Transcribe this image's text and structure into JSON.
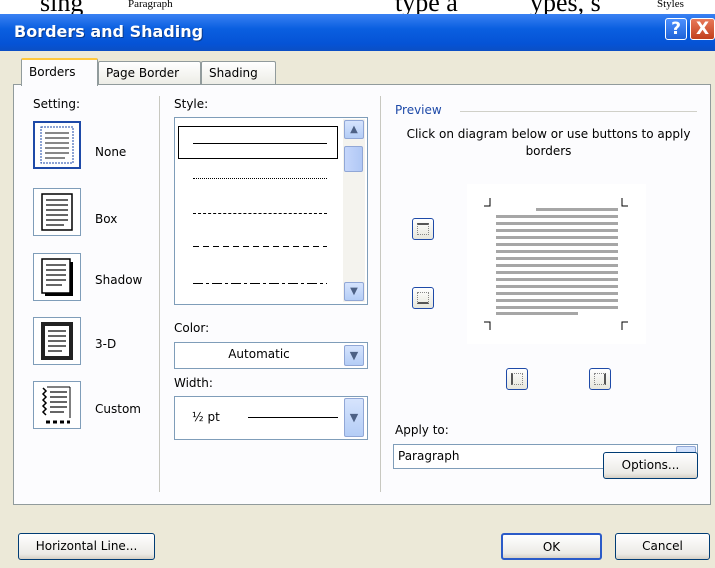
{
  "window": {
    "title": "Borders and Shading",
    "help_label": "?",
    "close_label": "X"
  },
  "background_doc": {
    "fragments": [
      "sing",
      "Paragraph",
      "type a",
      "ypes, s",
      "Styles"
    ]
  },
  "tabs": [
    {
      "label": "Borders",
      "active": true
    },
    {
      "label": "Page Border",
      "active": false
    },
    {
      "label": "Shading",
      "active": false
    }
  ],
  "setting": {
    "label": "Setting:",
    "options": [
      {
        "label": "None",
        "selected": true,
        "icon": "setting-none-icon"
      },
      {
        "label": "Box",
        "selected": false,
        "icon": "setting-box-icon"
      },
      {
        "label": "Shadow",
        "selected": false,
        "icon": "setting-shadow-icon"
      },
      {
        "label": "3-D",
        "selected": false,
        "icon": "setting-3d-icon"
      },
      {
        "label": "Custom",
        "selected": false,
        "icon": "setting-custom-icon"
      }
    ]
  },
  "style": {
    "label": "Style:",
    "items": [
      "solid",
      "dotted",
      "dashed-small",
      "dashed",
      "dash-dot"
    ],
    "selected": "solid"
  },
  "color": {
    "label": "Color:",
    "value": "Automatic"
  },
  "width": {
    "label": "Width:",
    "value": "½ pt"
  },
  "preview": {
    "label": "Preview",
    "hint": "Click on diagram below or use buttons to apply borders",
    "line_color": "#a6a6a6"
  },
  "apply_to": {
    "label": "Apply to:",
    "value": "Paragraph"
  },
  "buttons": {
    "options": "Options...",
    "horizontal_line": "Horizontal Line...",
    "ok": "OK",
    "cancel": "Cancel"
  },
  "colors": {
    "titlebar": "#0553d6",
    "accent_tab": "#ffc83c",
    "dialog_bg": "#ece9d8"
  }
}
